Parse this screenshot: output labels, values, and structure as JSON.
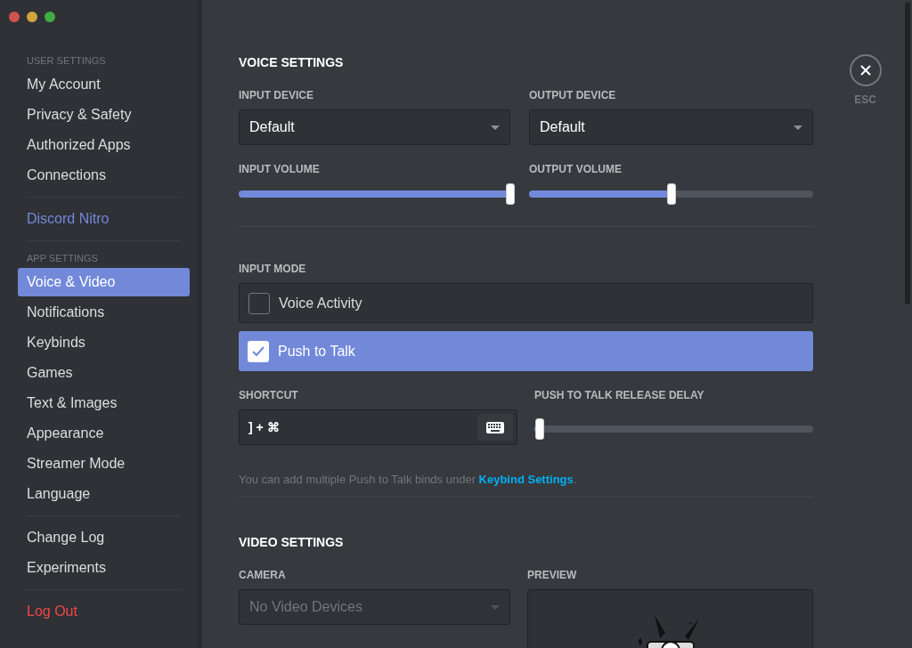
{
  "sidebar": {
    "groups": [
      {
        "header": "USER SETTINGS",
        "items": [
          {
            "label": "My Account",
            "kind": "normal",
            "selected": false
          },
          {
            "label": "Privacy & Safety",
            "kind": "normal",
            "selected": false
          },
          {
            "label": "Authorized Apps",
            "kind": "normal",
            "selected": false
          },
          {
            "label": "Connections",
            "kind": "normal",
            "selected": false
          }
        ]
      },
      {
        "items": [
          {
            "label": "Discord Nitro",
            "kind": "nitro",
            "selected": false
          }
        ]
      },
      {
        "header": "APP SETTINGS",
        "items": [
          {
            "label": "Voice & Video",
            "kind": "normal",
            "selected": true
          },
          {
            "label": "Notifications",
            "kind": "normal",
            "selected": false
          },
          {
            "label": "Keybinds",
            "kind": "normal",
            "selected": false
          },
          {
            "label": "Games",
            "kind": "normal",
            "selected": false
          },
          {
            "label": "Text & Images",
            "kind": "normal",
            "selected": false
          },
          {
            "label": "Appearance",
            "kind": "normal",
            "selected": false
          },
          {
            "label": "Streamer Mode",
            "kind": "normal",
            "selected": false
          },
          {
            "label": "Language",
            "kind": "normal",
            "selected": false
          }
        ]
      },
      {
        "items": [
          {
            "label": "Change Log",
            "kind": "normal",
            "selected": false
          },
          {
            "label": "Experiments",
            "kind": "normal",
            "selected": false
          }
        ]
      },
      {
        "items": [
          {
            "label": "Log Out",
            "kind": "danger",
            "selected": false
          }
        ]
      }
    ]
  },
  "voice": {
    "title": "VOICE SETTINGS",
    "devices": [
      {
        "label": "INPUT DEVICE",
        "value": "Default"
      },
      {
        "label": "OUTPUT DEVICE",
        "value": "Default"
      }
    ],
    "volumes": [
      {
        "label": "INPUT VOLUME",
        "level": 1.0
      },
      {
        "label": "OUTPUT VOLUME",
        "level": 0.5
      }
    ],
    "input_mode": {
      "label": "INPUT MODE",
      "options": [
        {
          "label": "Voice Activity",
          "selected": false
        },
        {
          "label": "Push to Talk",
          "selected": true
        }
      ]
    },
    "shortcut": {
      "label": "SHORTCUT",
      "value": "] + ⌘"
    },
    "release_delay": {
      "label": "PUSH TO TALK RELEASE DELAY",
      "level": 0.02
    },
    "hint": {
      "text": "You can add multiple Push to Talk binds under ",
      "link": "Keybind Settings",
      "end": "."
    }
  },
  "video": {
    "title": "VIDEO SETTINGS",
    "camera": {
      "label": "CAMERA",
      "value": "No Video Devices",
      "disabled": true
    },
    "preview": {
      "label": "PREVIEW"
    }
  },
  "close": {
    "label": "ESC"
  }
}
